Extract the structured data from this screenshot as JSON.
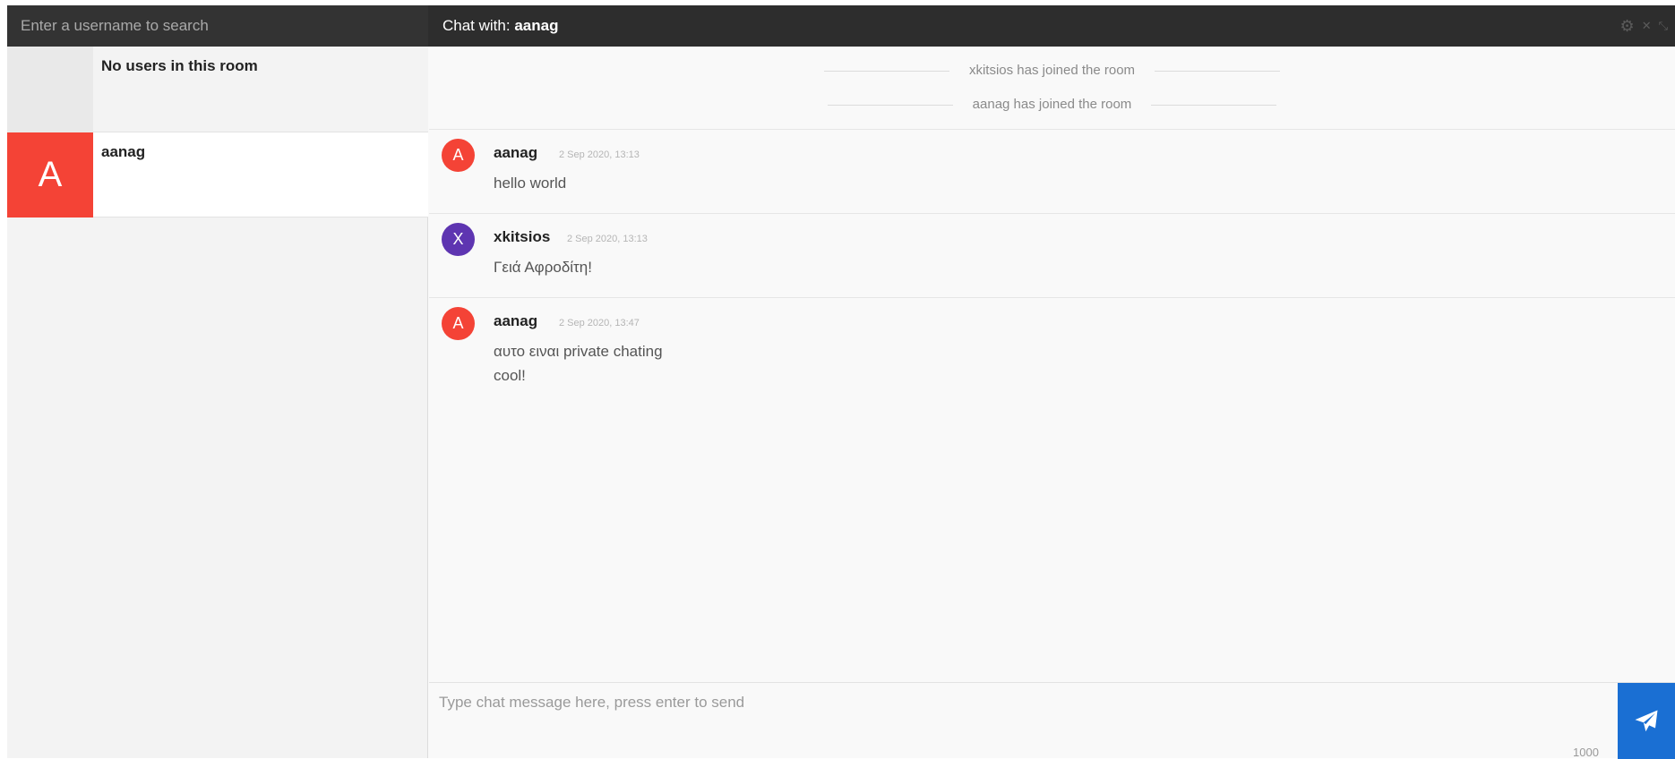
{
  "search": {
    "placeholder": "Enter a username to search"
  },
  "header": {
    "title_prefix": "Chat with:",
    "title_user": "aanag",
    "icons": [
      "gear-icon",
      "close-icon",
      "collapse-icon"
    ]
  },
  "sidebar": {
    "room_status": "No users in this room",
    "users": [
      {
        "initial": "A",
        "name": "aanag",
        "color": "#f44336"
      }
    ]
  },
  "system_messages": [
    "xkitsios has joined the room",
    "aanag has joined the room"
  ],
  "messages": [
    {
      "initial": "A",
      "author": "aanag",
      "time": "2 Sep 2020, 13:13",
      "lines": [
        "hello world"
      ],
      "color": "#f44336"
    },
    {
      "initial": "X",
      "author": "xkitsios",
      "time": "2 Sep 2020, 13:13",
      "lines": [
        "Γειά Αφροδίτη!"
      ],
      "color": "#5e35b1"
    },
    {
      "initial": "A",
      "author": "aanag",
      "time": "2 Sep 2020, 13:47",
      "lines": [
        "αυτο ειναι private chating",
        "cool!"
      ],
      "color": "#f44336"
    }
  ],
  "composer": {
    "placeholder": "Type chat message here, press enter to send",
    "char_limit": "1000",
    "send_icon": "paper-plane-icon"
  }
}
